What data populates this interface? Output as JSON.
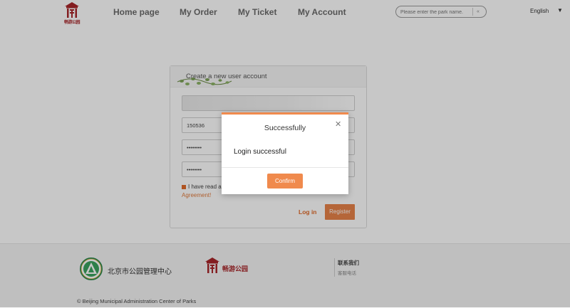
{
  "header": {
    "logo_text": "畅游公园",
    "nav": [
      "Home page",
      "My Order",
      "My Ticket",
      "My Account"
    ],
    "search_placeholder": "Please enter the park name.",
    "language": "English"
  },
  "card": {
    "title": "Create a new user account",
    "fields": [
      {
        "value": ""
      },
      {
        "value": "150536"
      },
      {
        "value": "••••••••"
      },
      {
        "value": "••••••••"
      }
    ],
    "agree_text": "I have read an",
    "agree_link": "Agreement!",
    "login_link": "Log in",
    "register_button": "Register"
  },
  "footer": {
    "org_name": "北京市公园管理中心",
    "brand": "畅游公园",
    "contact_title": "联系我们",
    "contact_phone": "客服电话",
    "copyright": "© Beijing Municipal Administration Center of Parks"
  },
  "modal": {
    "title": "Successfully",
    "message": "Login successful",
    "confirm_button": "Confirm"
  },
  "colors": {
    "accent": "#f08a4d",
    "brand_red": "#a8262a"
  },
  "icons": {
    "close": "close-icon",
    "logo": "pavilion-logo-icon",
    "dropdown": "chevron-down-icon"
  }
}
